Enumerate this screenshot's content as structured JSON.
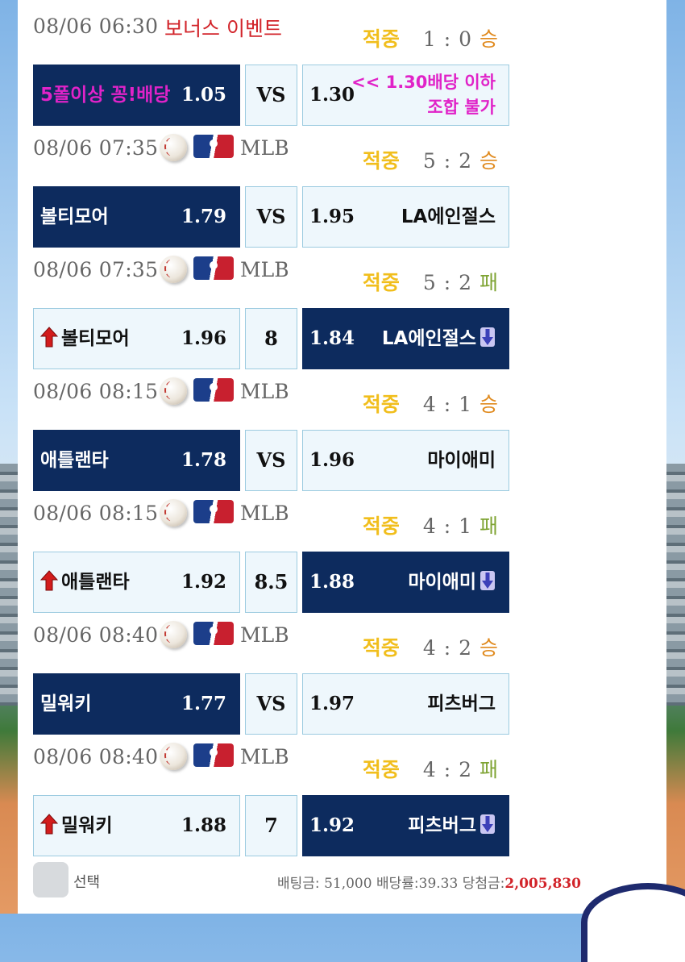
{
  "colors": {
    "dark_box": "#0d2b5e",
    "light_box": "#eef7fc",
    "status_hit": "#f1be1c",
    "win": "#e08a1e",
    "loss": "#7ea332",
    "event_red": "#d2242a",
    "event_magenta": "#e023c8"
  },
  "bets": [
    {
      "time": "08/06 06:30",
      "event_title": "보너스 이벤트",
      "status": "적중",
      "score": "1 : 0",
      "outcome": "승",
      "home": {
        "name": "5폴이상 꽁!배당",
        "odds": "1.05"
      },
      "middle": "VS",
      "away": {
        "name": "",
        "odds": "1.30"
      },
      "note_line1": "<< 1.30배당 이하",
      "note_line2": "조합 불가"
    },
    {
      "time": "08/06 07:35",
      "league": "MLB",
      "status": "적중",
      "score": "5 : 2",
      "outcome": "승",
      "home": {
        "name": "볼티모어",
        "odds": "1.79"
      },
      "middle": "VS",
      "away": {
        "name": "LA에인절스",
        "odds": "1.95"
      }
    },
    {
      "time": "08/06 07:35",
      "league": "MLB",
      "status": "적중",
      "score": "5 : 2",
      "outcome": "패",
      "home": {
        "name": "볼티모어",
        "odds": "1.96"
      },
      "middle": "8",
      "away": {
        "name": "LA에인절스",
        "odds": "1.84"
      }
    },
    {
      "time": "08/06 08:15",
      "league": "MLB",
      "status": "적중",
      "score": "4 : 1",
      "outcome": "승",
      "home": {
        "name": "애틀랜타",
        "odds": "1.78"
      },
      "middle": "VS",
      "away": {
        "name": "마이애미",
        "odds": "1.96"
      }
    },
    {
      "time": "08/06 08:15",
      "league": "MLB",
      "status": "적중",
      "score": "4 : 1",
      "outcome": "패",
      "home": {
        "name": "애틀랜타",
        "odds": "1.92"
      },
      "middle": "8.5",
      "away": {
        "name": "마이애미",
        "odds": "1.88"
      }
    },
    {
      "time": "08/06 08:40",
      "league": "MLB",
      "status": "적중",
      "score": "4 : 2",
      "outcome": "승",
      "home": {
        "name": "밀워키",
        "odds": "1.77"
      },
      "middle": "VS",
      "away": {
        "name": "피츠버그",
        "odds": "1.97"
      }
    },
    {
      "time": "08/06 08:40",
      "league": "MLB",
      "status": "적중",
      "score": "4 : 2",
      "outcome": "패",
      "home": {
        "name": "밀워키",
        "odds": "1.88"
      },
      "middle": "7",
      "away": {
        "name": "피츠버그",
        "odds": "1.92"
      }
    }
  ],
  "footer": {
    "select_label": "선택",
    "bet_label": "배팅금:",
    "bet_amount": "51,000",
    "rate_label": "배당률:",
    "rate": "39.33",
    "prize_label": "당첨금:",
    "prize": "2,005,830"
  }
}
